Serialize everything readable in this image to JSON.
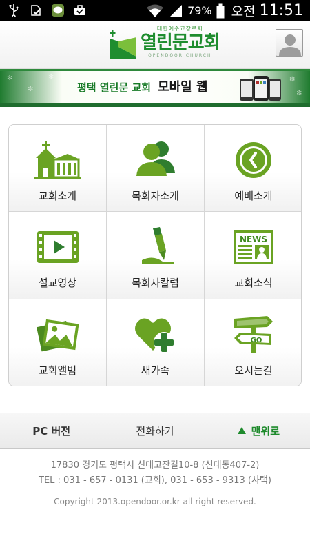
{
  "status_bar": {
    "icons": [
      "usb-icon",
      "download-done-icon",
      "line-app-icon",
      "briefcase-icon",
      "wifi-icon",
      "signal-icon"
    ],
    "battery": "79%",
    "ampm": "오전",
    "time": "11:51"
  },
  "header": {
    "logo_sub": "대한예수교장로회",
    "logo_name": "열린문교회",
    "logo_en": "OPENDOOR CHURCH",
    "avatar_icon": "user-icon"
  },
  "banner": {
    "text_a": "평택 열린문 교회",
    "text_b": "모바일 웹"
  },
  "menu": [
    {
      "label": "교회소개",
      "icon": "church-icon"
    },
    {
      "label": "목회자소개",
      "icon": "people-icon"
    },
    {
      "label": "예배소개",
      "icon": "clock-icon"
    },
    {
      "label": "설교영상",
      "icon": "video-icon"
    },
    {
      "label": "목회자칼럼",
      "icon": "pen-icon"
    },
    {
      "label": "교회소식",
      "icon": "news-icon"
    },
    {
      "label": "교회앨범",
      "icon": "album-icon"
    },
    {
      "label": "새가족",
      "icon": "heart-plus-icon"
    },
    {
      "label": "오시는길",
      "icon": "signpost-icon"
    }
  ],
  "news_icon_text": "NEWS",
  "go_icon_text": "GO",
  "bottom_bar": {
    "pc": "PC 버전",
    "call": "전화하기",
    "top": "맨위로"
  },
  "footer": {
    "address": "17830 경기도 평택시 신대고잔길10-8 (신대동407-2)",
    "tel": "TEL : 031 - 657 - 0131 (교회), 031 - 653 - 9313 (사택)",
    "copyright": "Copyright 2013.opendoor.or.kr all right reserved."
  },
  "colors": {
    "accent": "#1e8a2c",
    "icon_green": "#6aa323",
    "banner_green": "#1e6b2d"
  }
}
